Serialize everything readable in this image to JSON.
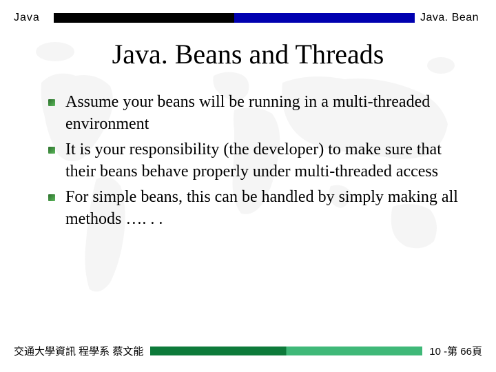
{
  "header": {
    "left": "Java",
    "right": "Java. Bean"
  },
  "title": "Java. Beans and Threads",
  "bullets": [
    "Assume your beans will be running in a multi-threaded environment",
    "It is your responsibility (the developer) to make sure that their beans behave properly under multi-threaded access",
    "For simple beans, this can be handled by simply making all methods …. . ."
  ],
  "footer": {
    "left": "交通大學資訊 程學系 蔡文能",
    "right": "10 -第 66頁"
  }
}
